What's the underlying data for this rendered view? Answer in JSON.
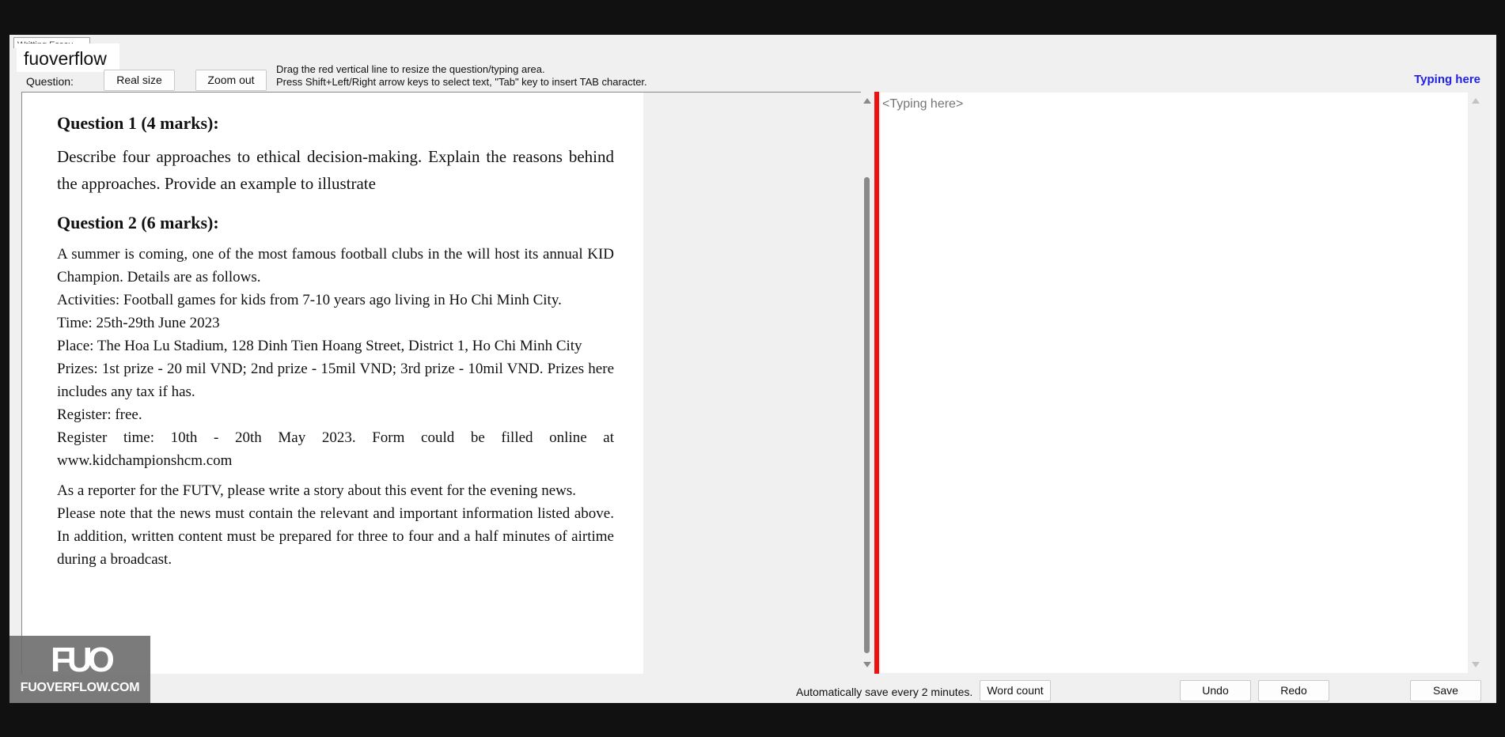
{
  "window": {
    "tab_label": "Writting Essay",
    "watermark_top": "fuoverflow"
  },
  "toolbar": {
    "question_label": "Question:",
    "real_size_label": "Real size",
    "zoom_out_label": "Zoom out",
    "hint_line1": "Drag the red vertical line to resize the question/typing area.",
    "hint_line2": "Press Shift+Left/Right arrow keys to select text, \"Tab\" key to insert TAB character.",
    "typing_here_link": "Typing here"
  },
  "question": {
    "q1_heading": "Question 1 (4 marks):",
    "q1_body": "Describe four approaches to ethical decision-making.  Explain the reasons behind the approaches. Provide an example to illustrate",
    "q2_heading": "Question 2 (6 marks):",
    "q2_lines": [
      "A summer is coming, one of the most famous football clubs in the will host its annual KID Champion. Details are as follows.",
      "Activities: Football games for kids from 7-10 years ago living in Ho Chi Minh City.",
      "Time: 25th-29th June 2023",
      "Place: The Hoa Lu Stadium, 128 Dinh Tien Hoang Street, District 1, Ho Chi Minh City",
      "Prizes: 1st prize - 20 mil VND; 2nd prize - 15mil VND; 3rd prize - 10mil VND. Prizes here includes any tax if has.",
      "Register: free.",
      "Register time: 10th - 20th May 2023. Form could be filled online at www.kidchampionshcm.com"
    ],
    "q2_task_lines": [
      "As a reporter for the FUTV, please write a story about this event for the evening news.",
      "Please note that the news must contain the relevant and important information listed above. In addition, written content must be prepared for three to four and a half minutes of airtime during a broadcast."
    ]
  },
  "answer": {
    "placeholder": "<Typing here>"
  },
  "footer": {
    "autosave_text": "Automatically save every 2 minutes.",
    "word_count_label": "Word count",
    "undo_label": "Undo",
    "redo_label": "Redo",
    "save_label": "Save"
  },
  "watermark": {
    "logo_text": "FUO",
    "site_text": "FUOVERFLOW.COM"
  },
  "colors": {
    "splitter": "#ee1111",
    "link": "#1f1fe6",
    "frame_background": "#111111"
  }
}
